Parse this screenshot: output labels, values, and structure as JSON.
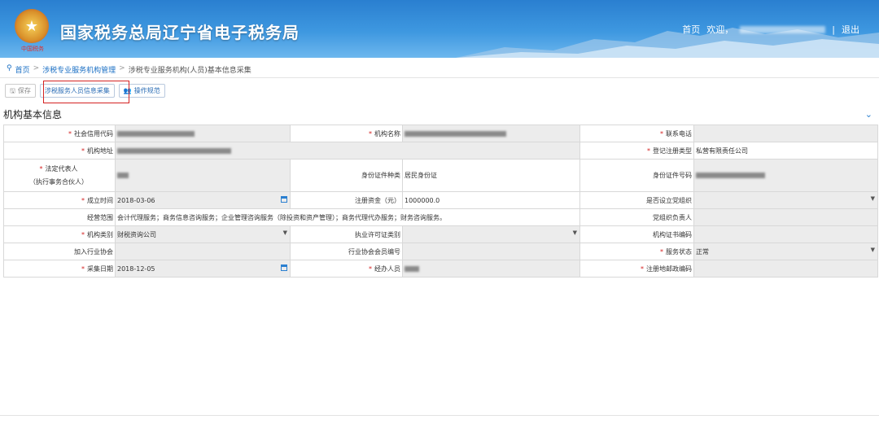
{
  "header": {
    "emblem_text": "中国税务",
    "title": "国家税务总局辽宁省电子税务局",
    "nav_home": "首页",
    "nav_welcome": "欢迎，",
    "nav_sep": "|",
    "nav_logout": "退出"
  },
  "breadcrumb": {
    "home": "首页",
    "sep": ">",
    "level1": "涉税专业服务机构管理",
    "level2": "涉税专业服务机构(人员)基本信息采集"
  },
  "toolbar": {
    "save": "保存",
    "collect": "涉税服务人员信息采集",
    "spec": "操作规范"
  },
  "section": {
    "title": "机构基本信息"
  },
  "form": {
    "credit_code_label": "社会信用代码",
    "org_name_label": "机构名称",
    "phone_label": "联系电话",
    "address_label": "机构地址",
    "reg_type_label": "登记注册类型",
    "reg_type_value": "私营有限责任公司",
    "legal_rep_label": "法定代表人",
    "legal_rep_sub": "（执行事务合伙人）",
    "id_type_label": "身份证件种类",
    "id_type_value": "居民身份证",
    "id_no_label": "身份证件号码",
    "est_date_label": "成立时间",
    "est_date_value": "2018-03-06",
    "capital_label": "注册资金（元）",
    "capital_value": "1000000.0",
    "party_org_label": "是否设立党组织",
    "scope_label": "经营范围",
    "scope_value": "会计代理服务；商务信息咨询服务；企业管理咨询服务（除投资和资产管理）；商务代理代办服务；财务咨询服务。",
    "party_leader_label": "党组织负责人",
    "org_category_label": "机构类别",
    "org_category_value": "财税资询公司",
    "license_type_label": "执业许可证类别",
    "org_cert_label": "机构证书编码",
    "assoc_label": "加入行业协会",
    "assoc_member_label": "行业协会会员编号",
    "service_status_label": "服务状态",
    "service_status_value": "正常",
    "collect_date_label": "采集日期",
    "collect_date_value": "2018-12-05",
    "handler_label": "经办人员",
    "postcode_label": "注册地邮政编码"
  }
}
